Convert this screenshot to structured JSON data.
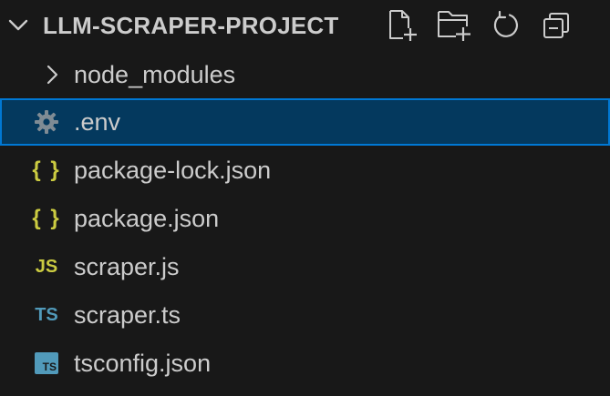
{
  "explorer": {
    "project_title": "LLM-SCRAPER-PROJECT",
    "actions": [
      {
        "name": "new-file-icon"
      },
      {
        "name": "new-folder-icon"
      },
      {
        "name": "refresh-icon"
      },
      {
        "name": "collapse-all-icon"
      }
    ],
    "items": [
      {
        "label": "node_modules",
        "type": "folder",
        "icon": "chevron-right-icon"
      },
      {
        "label": ".env",
        "type": "file",
        "icon": "gear-icon",
        "selected": true
      },
      {
        "label": "package-lock.json",
        "type": "file",
        "icon": "json-icon",
        "icon_text": "{ }"
      },
      {
        "label": "package.json",
        "type": "file",
        "icon": "json-icon",
        "icon_text": "{ }"
      },
      {
        "label": "scraper.js",
        "type": "file",
        "icon": "javascript-icon",
        "icon_text": "JS"
      },
      {
        "label": "scraper.ts",
        "type": "file",
        "icon": "typescript-icon",
        "icon_text": "TS"
      },
      {
        "label": "tsconfig.json",
        "type": "file",
        "icon": "tsconfig-icon",
        "icon_text": "TS"
      }
    ]
  },
  "colors": {
    "background": "#181818",
    "text": "#cccccc",
    "selection_background": "#04395e",
    "selection_border": "#0078d4",
    "json_js_yellow": "#cbcb41",
    "ts_blue": "#519aba"
  }
}
